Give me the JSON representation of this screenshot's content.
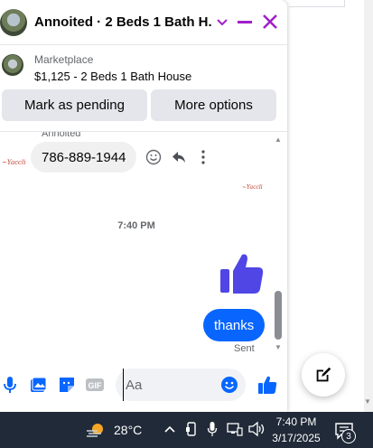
{
  "chat": {
    "title": "Annoited · 2 Beds 1 Bath H...",
    "listing": {
      "label": "Marketplace",
      "title": "$1,125 - 2 Beds 1 Bath House"
    },
    "actions": {
      "pending_label": "Mark as pending",
      "more_label": "More options"
    },
    "messages": {
      "sender_name": "Annoited",
      "phone_text": "786-889-1944",
      "timestamp": "7:40 PM",
      "reply_text": "thanks",
      "sent_status": "Sent"
    },
    "composer": {
      "placeholder": "Aa"
    },
    "colors": {
      "accent": "#0866ff",
      "header_icons": "#a020c8",
      "thumbs": "#4f46e5"
    }
  },
  "taskbar": {
    "temperature": "28°C",
    "time": "7:40 PM",
    "date": "3/17/2025",
    "notification_count": "3"
  }
}
